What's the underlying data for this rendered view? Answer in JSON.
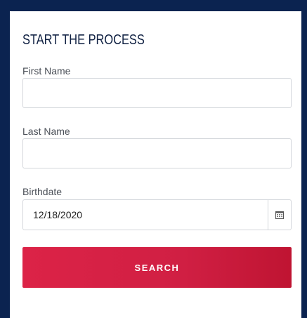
{
  "form": {
    "title": "START THE PROCESS",
    "first_name": {
      "label": "First Name",
      "value": "",
      "placeholder": ""
    },
    "last_name": {
      "label": "Last Name",
      "value": "",
      "placeholder": ""
    },
    "birthdate": {
      "label": "Birthdate",
      "value": "12/18/2020",
      "icon": "calendar-icon"
    },
    "search_label": "SEARCH"
  },
  "colors": {
    "frame": "#0b2350",
    "title": "#0f2042",
    "button": "#d01f43"
  }
}
